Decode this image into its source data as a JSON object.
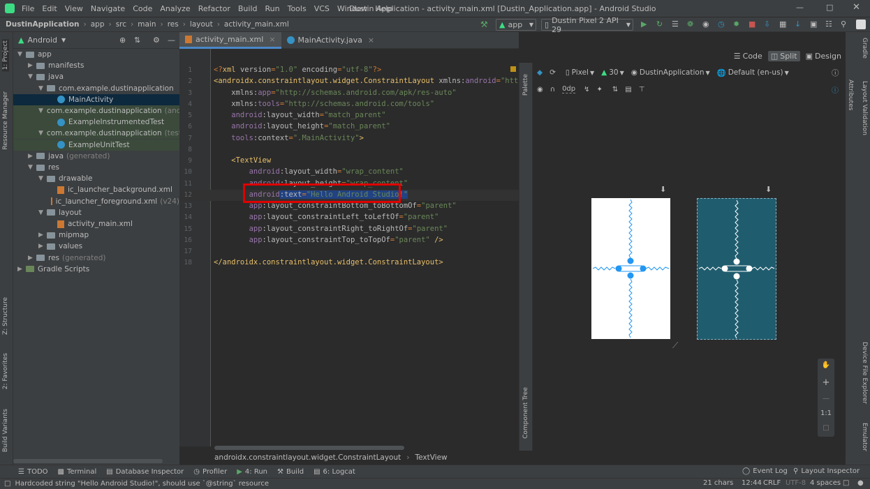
{
  "window": {
    "title": "Dustin Application - activity_main.xml [Dustin_Application.app] - Android Studio"
  },
  "menu": [
    "File",
    "Edit",
    "View",
    "Navigate",
    "Code",
    "Analyze",
    "Refactor",
    "Build",
    "Run",
    "Tools",
    "VCS",
    "Window",
    "Help"
  ],
  "breadcrumb": [
    "DustinApplication",
    "app",
    "src",
    "main",
    "res",
    "layout",
    "activity_main.xml"
  ],
  "toolbar": {
    "run_config": "app",
    "device": "Dustin Pixel 2 API 29"
  },
  "project_panel": {
    "view_mode": "Android",
    "tree": [
      {
        "label": "app",
        "depth": 0,
        "type": "folder",
        "expanded": true
      },
      {
        "label": "manifests",
        "depth": 1,
        "type": "folder",
        "expanded": false
      },
      {
        "label": "java",
        "depth": 1,
        "type": "folder",
        "expanded": true
      },
      {
        "label": "com.example.dustinapplication",
        "depth": 2,
        "type": "package",
        "expanded": true
      },
      {
        "label": "MainActivity",
        "depth": 3,
        "type": "class",
        "selected": true
      },
      {
        "label": "com.example.dustinapplication",
        "suffix": "(android",
        "depth": 2,
        "type": "package",
        "expanded": true
      },
      {
        "label": "ExampleInstrumentedTest",
        "depth": 3,
        "type": "class"
      },
      {
        "label": "com.example.dustinapplication",
        "suffix": "(test)",
        "depth": 2,
        "type": "package",
        "expanded": true
      },
      {
        "label": "ExampleUnitTest",
        "depth": 3,
        "type": "class"
      },
      {
        "label": "java",
        "suffix": "(generated)",
        "depth": 1,
        "type": "folder",
        "expanded": false
      },
      {
        "label": "res",
        "depth": 1,
        "type": "folder",
        "expanded": true
      },
      {
        "label": "drawable",
        "depth": 2,
        "type": "folder",
        "expanded": true
      },
      {
        "label": "ic_launcher_background.xml",
        "depth": 3,
        "type": "xml"
      },
      {
        "label": "ic_launcher_foreground.xml",
        "suffix": "(v24)",
        "depth": 3,
        "type": "xml"
      },
      {
        "label": "layout",
        "depth": 2,
        "type": "folder",
        "expanded": true
      },
      {
        "label": "activity_main.xml",
        "depth": 3,
        "type": "xml"
      },
      {
        "label": "mipmap",
        "depth": 2,
        "type": "folder",
        "expanded": false
      },
      {
        "label": "values",
        "depth": 2,
        "type": "folder",
        "expanded": false
      },
      {
        "label": "res",
        "suffix": "(generated)",
        "depth": 1,
        "type": "folder",
        "expanded": false
      },
      {
        "label": "Gradle Scripts",
        "depth": 0,
        "type": "gradle",
        "expanded": false
      }
    ]
  },
  "tabs": [
    {
      "label": "activity_main.xml",
      "active": true
    },
    {
      "label": "MainActivity.java",
      "active": false
    }
  ],
  "editor": {
    "lines": [
      [
        [
          "pun",
          "<?"
        ],
        [
          "tag",
          "xml "
        ],
        [
          "attr",
          "version"
        ],
        [
          "pun",
          "="
        ],
        [
          "val",
          "\"1.0\" "
        ],
        [
          "attr",
          "encoding"
        ],
        [
          "pun",
          "="
        ],
        [
          "val",
          "\"utf-8\""
        ],
        [
          "pun",
          "?>"
        ]
      ],
      [
        [
          "tag",
          "<androidx.constraintlayout.widget.ConstraintLayout "
        ],
        [
          "attr",
          "xmlns:"
        ],
        [
          "ns",
          "android"
        ],
        [
          "pun",
          "="
        ],
        [
          "val",
          "\"http://sc"
        ]
      ],
      [
        [
          "attr",
          "    xmlns:"
        ],
        [
          "ns",
          "app"
        ],
        [
          "pun",
          "="
        ],
        [
          "val",
          "\"http://schemas.android.com/apk/res-auto\""
        ]
      ],
      [
        [
          "attr",
          "    xmlns:"
        ],
        [
          "ns",
          "tools"
        ],
        [
          "pun",
          "="
        ],
        [
          "val",
          "\"http://schemas.android.com/tools\""
        ]
      ],
      [
        [
          "ns",
          "    android"
        ],
        [
          "attr",
          ":layout_width"
        ],
        [
          "pun",
          "="
        ],
        [
          "val",
          "\"match_parent\""
        ]
      ],
      [
        [
          "ns",
          "    android"
        ],
        [
          "attr",
          ":layout_height"
        ],
        [
          "pun",
          "="
        ],
        [
          "val",
          "\"match_parent\""
        ]
      ],
      [
        [
          "ns",
          "    tools"
        ],
        [
          "attr",
          ":context"
        ],
        [
          "pun",
          "="
        ],
        [
          "val",
          "\".MainActivity\""
        ],
        [
          "tag",
          ">"
        ]
      ],
      [],
      [
        [
          "tag",
          "    <TextView"
        ]
      ],
      [
        [
          "ns",
          "        android"
        ],
        [
          "attr",
          ":layout_width"
        ],
        [
          "pun",
          "="
        ],
        [
          "val",
          "\"wrap_content\""
        ]
      ],
      [
        [
          "ns",
          "        android"
        ],
        [
          "attr",
          ":layout_height"
        ],
        [
          "pun",
          "="
        ],
        [
          "val",
          "\"wrap_content\""
        ]
      ],
      [
        [
          "ns",
          "        android"
        ],
        [
          "attr",
          ":text"
        ],
        [
          "pun",
          "="
        ],
        [
          "val",
          "\"Hello Android Studio!\""
        ]
      ],
      [
        [
          "ns",
          "        app"
        ],
        [
          "attr",
          ":layout_constraintBottom_toBottomOf"
        ],
        [
          "pun",
          "="
        ],
        [
          "val",
          "\"parent\""
        ]
      ],
      [
        [
          "ns",
          "        app"
        ],
        [
          "attr",
          ":layout_constraintLeft_toLeftOf"
        ],
        [
          "pun",
          "="
        ],
        [
          "val",
          "\"parent\""
        ]
      ],
      [
        [
          "ns",
          "        app"
        ],
        [
          "attr",
          ":layout_constraintRight_toRightOf"
        ],
        [
          "pun",
          "="
        ],
        [
          "val",
          "\"parent\""
        ]
      ],
      [
        [
          "ns",
          "        app"
        ],
        [
          "attr",
          ":layout_constraintTop_toTopOf"
        ],
        [
          "pun",
          "="
        ],
        [
          "val",
          "\"parent\" "
        ],
        [
          "tag",
          "/>"
        ]
      ],
      [],
      [
        [
          "tag",
          "</androidx.constraintlayout.widget.ConstraintLayout>"
        ]
      ]
    ],
    "line_numbers": [
      "1",
      "2",
      "3",
      "4",
      "5",
      "6",
      "7",
      "8",
      "9",
      "10",
      "11",
      "12",
      "13",
      "14",
      "15",
      "16",
      "17",
      "18"
    ],
    "breadcrumb": [
      "androidx.constraintlayout.widget.ConstraintLayout",
      "TextView"
    ],
    "highlighted_line": 12
  },
  "view_modes": [
    "Code",
    "Split",
    "Design"
  ],
  "design_toolbar": {
    "device": "Pixel",
    "api": "30",
    "theme": "DustinApplication",
    "locale": "Default (en-us)",
    "margin": "0dp"
  },
  "zoom_controls": {
    "one_to_one": "1:1"
  },
  "left_tool_windows": [
    "1: Project",
    "Resource Manager",
    "Z: Structure",
    "2: Favorites",
    "Build Variants"
  ],
  "right_tool_windows": [
    "Gradle",
    "Attributes",
    "Layout Validation",
    "Device File Explorer",
    "Emulator"
  ],
  "palette_labels": [
    "Palette",
    "Component Tree"
  ],
  "bottom_tools": [
    "TODO",
    "Terminal",
    "Database Inspector",
    "Profiler",
    "4: Run",
    "Build",
    "6: Logcat"
  ],
  "bottom_tools_right": [
    "Event Log",
    "Layout Inspector"
  ],
  "status": {
    "message": "Hardcoded string \"Hello Android Studio!\", should use `@string` resource",
    "chars": "21 chars",
    "position": "12:44",
    "line_sep": "CRLF",
    "encoding": "UTF-8",
    "indent": "4 spaces"
  },
  "colors": {
    "blueprint": "#1f5c6e",
    "accent": "#2196f3",
    "highlight_box": "#e00000",
    "selection": "#214283"
  }
}
